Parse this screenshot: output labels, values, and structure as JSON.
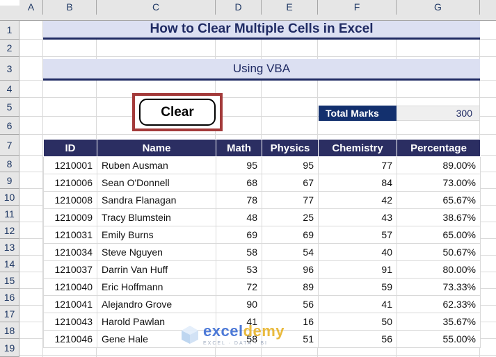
{
  "spreadsheet": {
    "columns": [
      "A",
      "B",
      "C",
      "D",
      "E",
      "F",
      "G"
    ],
    "rows": [
      "1",
      "2",
      "3",
      "4",
      "5",
      "6",
      "7",
      "8",
      "9",
      "10",
      "11",
      "12",
      "13",
      "14",
      "15",
      "16",
      "17",
      "18",
      "19"
    ],
    "select_all": "select-all-corner"
  },
  "banners": {
    "title": "How to Clear Multiple Cells in Excel",
    "subtitle": "Using VBA",
    "band_color": "#dce0f2",
    "text_color": "#1f2a63"
  },
  "clear_button": {
    "label": "Clear",
    "frame_color": "#a33a3a",
    "border_color": "#000000"
  },
  "total_marks": {
    "label": "Total Marks",
    "value": "300",
    "label_bg": "#13306e",
    "value_bg": "#efefef"
  },
  "table": {
    "header_bg": "#2b2e62",
    "headers": [
      "ID",
      "Name",
      "Math",
      "Physics",
      "Chemistry",
      "Percentage"
    ],
    "rows": [
      {
        "id": "1210001",
        "name": "Ruben Ausman",
        "math": "95",
        "physics": "95",
        "chemistry": "77",
        "percentage": "89.00%"
      },
      {
        "id": "1210006",
        "name": "Sean O'Donnell",
        "math": "68",
        "physics": "67",
        "chemistry": "84",
        "percentage": "73.00%"
      },
      {
        "id": "1210008",
        "name": "Sandra Flanagan",
        "math": "78",
        "physics": "77",
        "chemistry": "42",
        "percentage": "65.67%"
      },
      {
        "id": "1210009",
        "name": "Tracy Blumstein",
        "math": "48",
        "physics": "25",
        "chemistry": "43",
        "percentage": "38.67%"
      },
      {
        "id": "1210031",
        "name": "Emily Burns",
        "math": "69",
        "physics": "69",
        "chemistry": "57",
        "percentage": "65.00%"
      },
      {
        "id": "1210034",
        "name": "Steve Nguyen",
        "math": "58",
        "physics": "54",
        "chemistry": "40",
        "percentage": "50.67%"
      },
      {
        "id": "1210037",
        "name": "Darrin Van Huff",
        "math": "53",
        "physics": "96",
        "chemistry": "91",
        "percentage": "80.00%"
      },
      {
        "id": "1210040",
        "name": "Eric Hoffmann",
        "math": "72",
        "physics": "89",
        "chemistry": "59",
        "percentage": "73.33%"
      },
      {
        "id": "1210041",
        "name": "Alejandro Grove",
        "math": "90",
        "physics": "56",
        "chemistry": "41",
        "percentage": "62.33%"
      },
      {
        "id": "1210043",
        "name": "Harold Pawlan",
        "math": "41",
        "physics": "16",
        "chemistry": "50",
        "percentage": "35.67%"
      },
      {
        "id": "1210046",
        "name": "Gene Hale",
        "math": "58",
        "physics": "51",
        "chemistry": "56",
        "percentage": "55.00%"
      }
    ]
  },
  "watermark": {
    "part1": "excel",
    "part2": "demy",
    "tagline": "EXCEL · DATA · BI"
  }
}
